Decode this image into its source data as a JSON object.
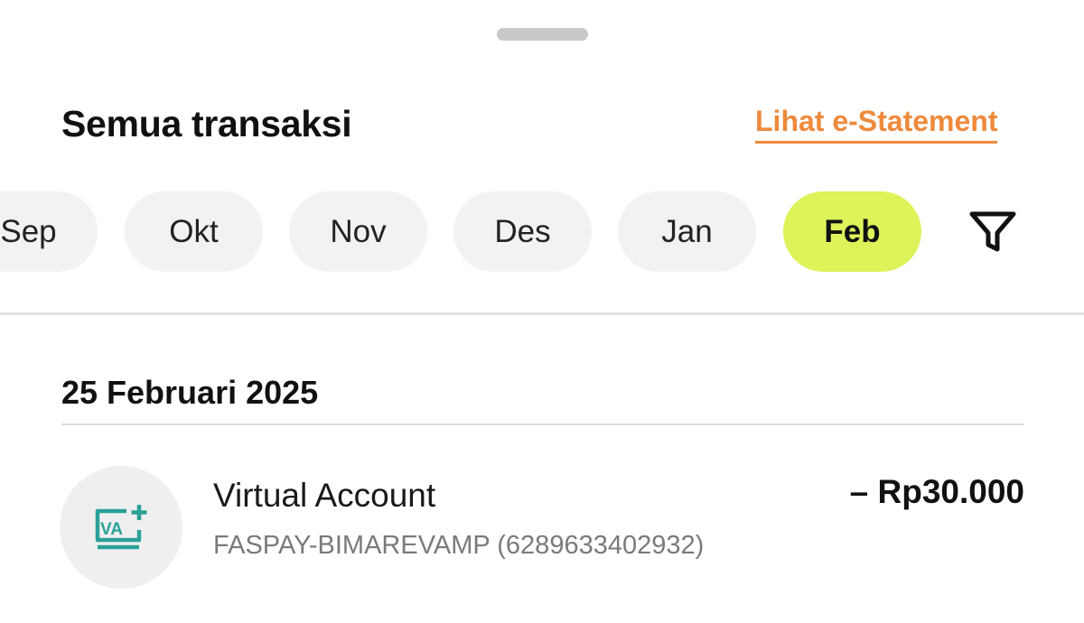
{
  "header": {
    "title": "Semua transaksi",
    "estatement_link": "Lihat e-Statement"
  },
  "months": [
    {
      "label": "Sep",
      "active": false
    },
    {
      "label": "Okt",
      "active": false
    },
    {
      "label": "Nov",
      "active": false
    },
    {
      "label": "Des",
      "active": false
    },
    {
      "label": "Jan",
      "active": false
    },
    {
      "label": "Feb",
      "active": true
    }
  ],
  "filter": {
    "icon": "filter-funnel-icon"
  },
  "transactions": {
    "date": "25 Februari 2025",
    "items": [
      {
        "title": "Virtual Account",
        "subtitle": "FASPAY-BIMAREVAMP (6289633402932)",
        "amount": "– Rp30.000",
        "icon": "virtual-account-icon",
        "icon_text": "VA"
      }
    ]
  },
  "colors": {
    "accent": "#ee8a3c",
    "active_chip": "#def25a",
    "chip": "#f2f2f2",
    "va_icon": "#2aa198"
  }
}
